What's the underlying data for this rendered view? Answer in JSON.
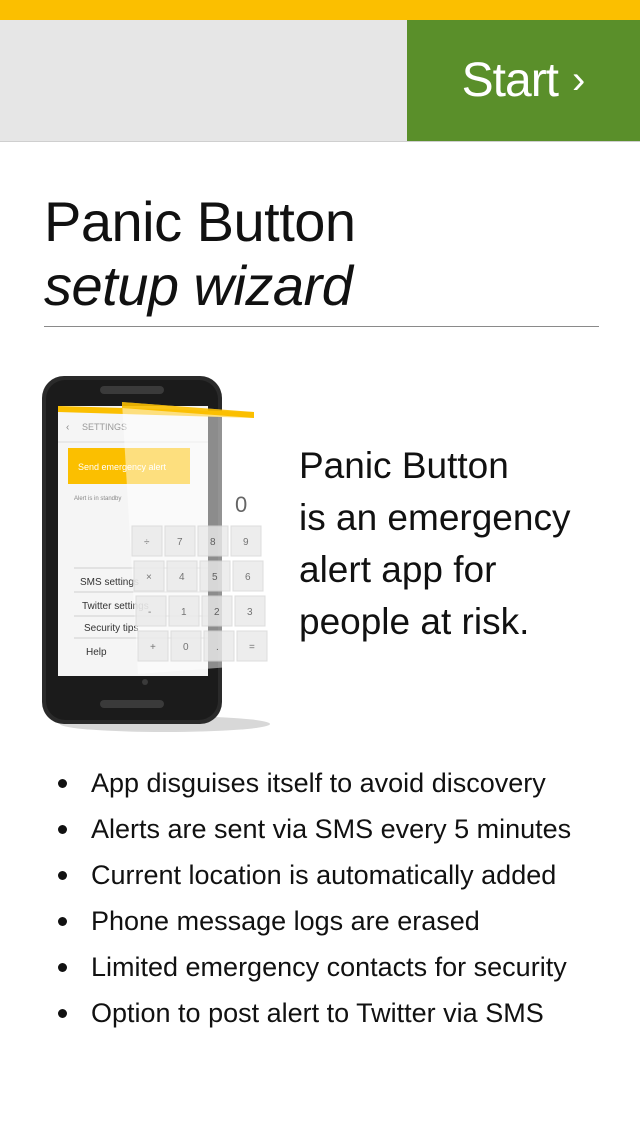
{
  "header": {
    "start_label": "Start",
    "start_chevron": "›"
  },
  "title": {
    "main": "Panic Button",
    "sub": "setup wizard"
  },
  "illustration": {
    "settings_label": "SETTINGS",
    "alert_button_label": "Send emergency alert",
    "status_text": "Alert is in standby",
    "menu_items": [
      "SMS settings",
      "Twitter settings",
      "Security tips",
      "Help"
    ],
    "calculator_display": "0",
    "calculator_keys": [
      "÷",
      "7",
      "8",
      "9",
      "×",
      "4",
      "5",
      "6",
      "-",
      "1",
      "2",
      "3",
      "+",
      "0",
      ".",
      "="
    ]
  },
  "intro": {
    "lines": [
      "Panic Button",
      "is an emergency",
      "alert app for",
      "people at risk."
    ]
  },
  "features": [
    "App disguises itself to avoid discovery",
    "Alerts are sent via SMS every 5 minutes",
    "Current location is automatically added",
    "Phone message logs are erased",
    "Limited emergency contacts for security",
    "Option to post alert to Twitter via SMS"
  ],
  "colors": {
    "top_stripe": "#fbbf00",
    "start_button": "#5a8f2a",
    "header_bg": "#e6e6e6"
  }
}
